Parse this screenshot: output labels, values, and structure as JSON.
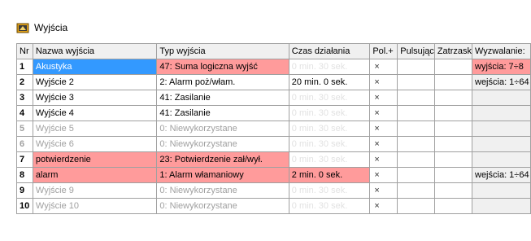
{
  "window": {
    "title": "Wyjścia"
  },
  "columns": [
    "Nr",
    "Nazwa wyjścia",
    "Typ wyjścia",
    "Czas działania",
    "Pol.+",
    "Pulsując",
    "Zatrzask",
    "Wyzwalanie:"
  ],
  "rows": [
    {
      "nr": "1",
      "name": "Akustyka",
      "type": "47: Suma logiczna wyjść",
      "time": "0  min. 30  sek.",
      "pol": "×",
      "trigger": "wyjścia: 7÷8"
    },
    {
      "nr": "2",
      "name": "Wyjście   2",
      "type": "2: Alarm poż/włam.",
      "time": "20 min. 0  sek.",
      "pol": "×",
      "trigger": "wejścia: 1÷64"
    },
    {
      "nr": "3",
      "name": "Wyjście   3",
      "type": "41: Zasilanie",
      "time": "0  min. 30  sek.",
      "pol": "×",
      "trigger": ""
    },
    {
      "nr": "4",
      "name": "Wyjście   4",
      "type": "41: Zasilanie",
      "time": "0  min. 30  sek.",
      "pol": "×",
      "trigger": ""
    },
    {
      "nr": "5",
      "name": "Wyjście   5",
      "type": "0: Niewykorzystane",
      "time": "0  min. 30  sek.",
      "pol": "×",
      "trigger": ""
    },
    {
      "nr": "6",
      "name": "Wyjście   6",
      "type": "0: Niewykorzystane",
      "time": "0  min. 30  sek.",
      "pol": "×",
      "trigger": ""
    },
    {
      "nr": "7",
      "name": "potwierdzenie",
      "type": "23: Potwierdzenie zał/wył.",
      "time": "0  min. 30  sek.",
      "pol": "×",
      "trigger": ""
    },
    {
      "nr": "8",
      "name": "alarm",
      "type": "1: Alarm włamaniowy",
      "time": "2  min. 0  sek.",
      "pol": "×",
      "trigger": "wejścia: 1÷64"
    },
    {
      "nr": "9",
      "name": "Wyjście   9",
      "type": "0: Niewykorzystane",
      "time": "0  min. 30  sek.",
      "pol": "×",
      "trigger": ""
    },
    {
      "nr": "10",
      "name": "Wyjście  10",
      "type": "0: Niewykorzystane",
      "time": "0  min. 30  sek.",
      "pol": "×",
      "trigger": ""
    }
  ]
}
